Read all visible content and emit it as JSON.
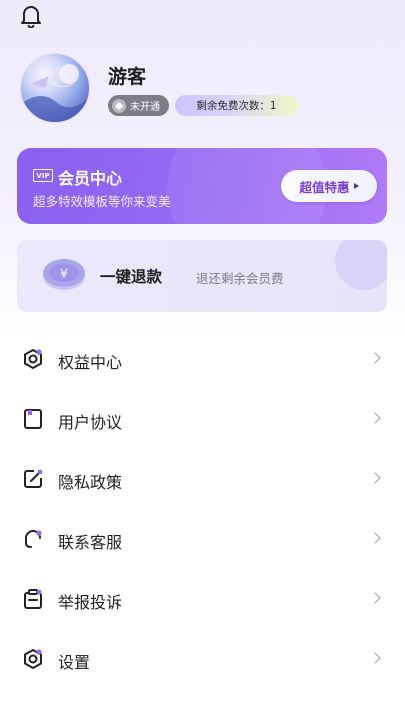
{
  "profile": {
    "username": "游客",
    "status_badge": "未开通",
    "free_badge": "剩余免费次数：1"
  },
  "vip": {
    "tag": "VIP",
    "title": "会员中心",
    "subtitle": "超多特效模板等你来变美",
    "button": "超值特惠"
  },
  "refund": {
    "currency_symbol": "¥",
    "title": "一键退款",
    "subtitle": "退还剩余会员费"
  },
  "menu": [
    {
      "label": "权益中心",
      "icon": "hexagon-icon"
    },
    {
      "label": "用户协议",
      "icon": "document-icon"
    },
    {
      "label": "隐私政策",
      "icon": "edit-icon"
    },
    {
      "label": "联系客服",
      "icon": "headset-icon"
    },
    {
      "label": "举报投诉",
      "icon": "clipboard-icon"
    },
    {
      "label": "设置",
      "icon": "settings-icon"
    }
  ],
  "colors": {
    "accent_purple": "#8a60f0",
    "icon_dot": "#8f6cf2"
  }
}
